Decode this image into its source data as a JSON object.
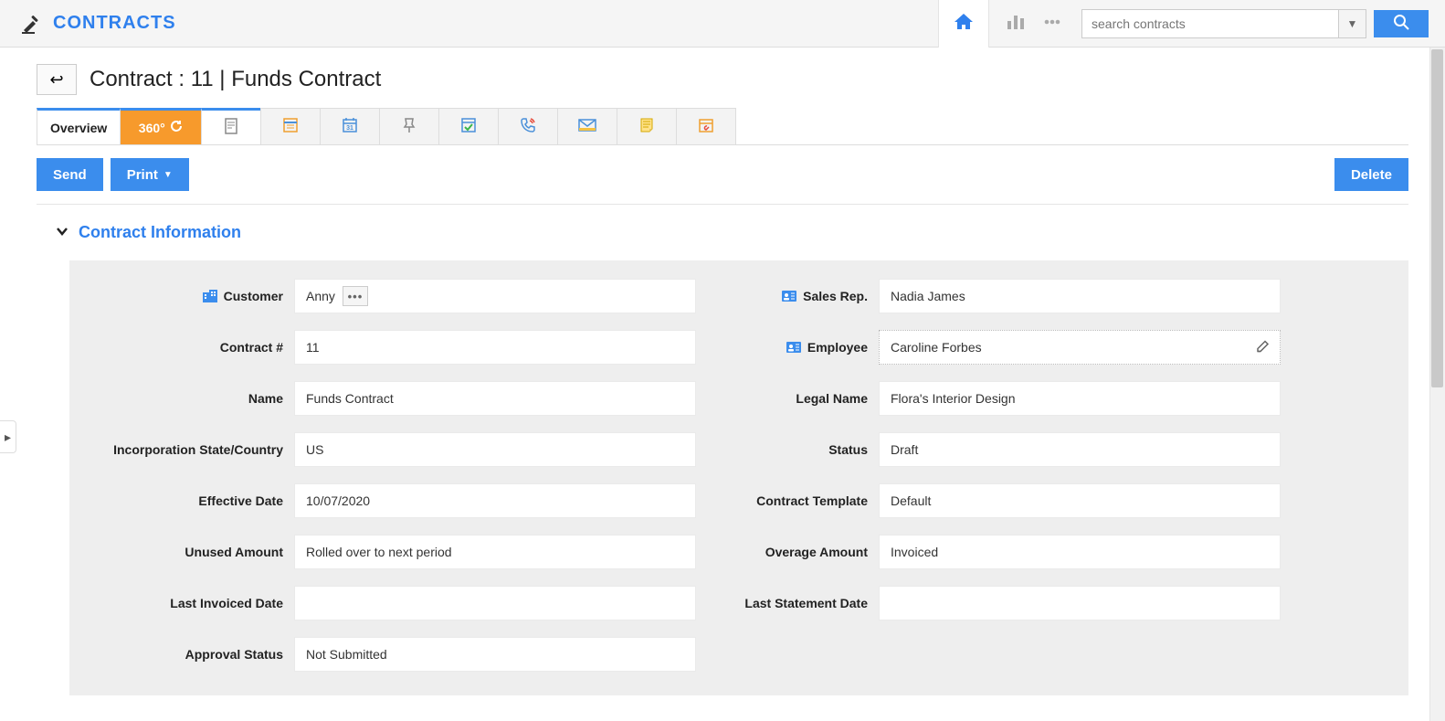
{
  "brand": "CONTRACTS",
  "search": {
    "placeholder": "search contracts"
  },
  "page": {
    "title": "Contract : 11 | Funds Contract"
  },
  "tabs": {
    "overview": "Overview",
    "t360": "360°"
  },
  "actions": {
    "send": "Send",
    "print": "Print",
    "delete": "Delete"
  },
  "section": {
    "title": "Contract Information"
  },
  "labels": {
    "customer": "Customer",
    "contractNo": "Contract #",
    "name": "Name",
    "incorp": "Incorporation State/Country",
    "effDate": "Effective Date",
    "unused": "Unused Amount",
    "lastInvoiced": "Last Invoiced Date",
    "approval": "Approval Status",
    "salesRep": "Sales Rep.",
    "employee": "Employee",
    "legalName": "Legal Name",
    "status": "Status",
    "template": "Contract Template",
    "overage": "Overage Amount",
    "lastStatement": "Last Statement Date"
  },
  "values": {
    "customer": "Anny",
    "contractNo": "11",
    "name": "Funds Contract",
    "incorp": "US",
    "effDate": "10/07/2020",
    "unused": "Rolled over to next period",
    "lastInvoiced": "",
    "approval": "Not Submitted",
    "salesRep": "Nadia James",
    "employee": "Caroline Forbes",
    "legalName": "Flora's Interior Design",
    "status": "Draft",
    "template": "Default",
    "overage": "Invoiced",
    "lastStatement": ""
  }
}
